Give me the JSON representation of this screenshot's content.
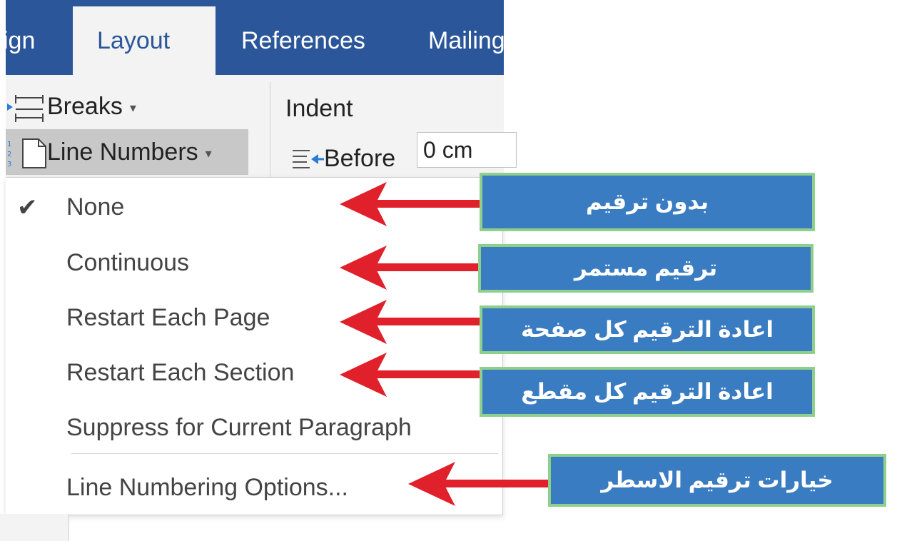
{
  "ribbon": {
    "tabs": [
      {
        "label": "ign"
      },
      {
        "label": "Layout"
      },
      {
        "label": "References"
      },
      {
        "label": "Mailing"
      }
    ],
    "breaks_label": "Breaks",
    "line_numbers_label": "Line Numbers",
    "indent_label": "Indent",
    "before_label": "Before",
    "before_value": "0 cm"
  },
  "menu": {
    "items": [
      {
        "label": "None",
        "checked": true
      },
      {
        "label": "Continuous"
      },
      {
        "label": "Restart Each Page"
      },
      {
        "label": "Restart Each Section"
      },
      {
        "label": "Suppress for Current Paragraph"
      },
      {
        "label": "Line Numbering Options..."
      }
    ]
  },
  "callouts": [
    {
      "text": "بدون ترقيم"
    },
    {
      "text": "ترقيم مستمر"
    },
    {
      "text": "اعادة الترقيم كل صفحة"
    },
    {
      "text": "اعادة الترقيم كل مقطع"
    },
    {
      "text": "خيارات ترقيم الاسطر"
    }
  ],
  "colors": {
    "tab_bar": "#2b579a",
    "callout_fill": "#3a7cc1",
    "callout_border": "#8fcf8c",
    "arrow": "#e0202a"
  },
  "icons": [
    "check-icon",
    "breaks-icon",
    "line-numbers-icon",
    "indent-before-icon",
    "dropdown-caret-icon"
  ]
}
